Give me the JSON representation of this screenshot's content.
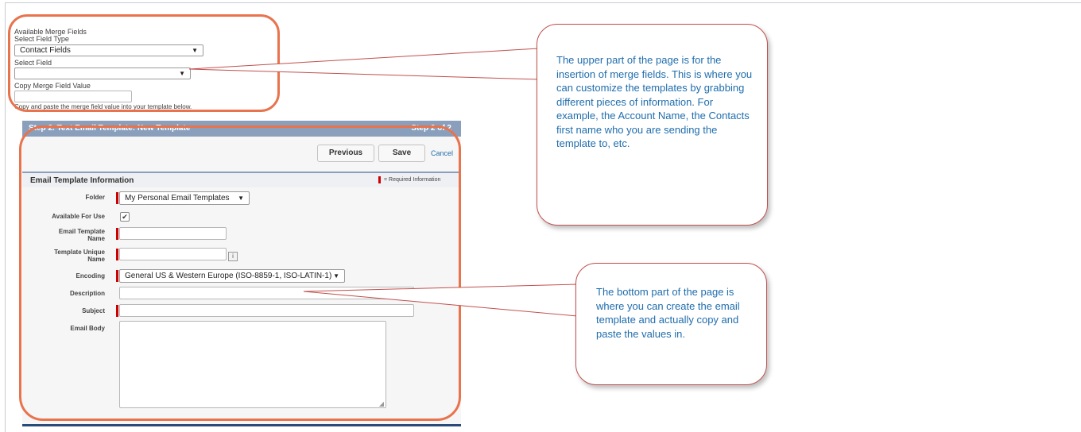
{
  "merge": {
    "title": "Available Merge Fields",
    "field_type_label": "Select Field Type",
    "field_type_value": "Contact Fields",
    "select_field_label": "Select Field",
    "select_field_value": "",
    "copy_label": "Copy Merge Field Value",
    "copy_value": "",
    "hint": "Copy and paste the merge field value into your template below."
  },
  "step": {
    "title": "Step 2. Text Email Template: New Template",
    "counter": "Step 2 of 2"
  },
  "buttons": {
    "previous": "Previous",
    "save": "Save",
    "cancel": "Cancel"
  },
  "section": {
    "title": "Email Template Information",
    "required_note": "= Required Information"
  },
  "form": {
    "folder_label": "Folder",
    "folder_value": "My Personal Email Templates",
    "available_label": "Available For Use",
    "available_checked": true,
    "name_label_1": "Email Template",
    "name_label_2": "Name",
    "unique_label_1": "Template Unique",
    "unique_label_2": "Name",
    "info_icon": "i",
    "encoding_label": "Encoding",
    "encoding_value": "General US & Western Europe (ISO-8859-1, ISO-LATIN-1)",
    "description_label": "Description",
    "subject_label": "Subject",
    "body_label": "Email Body"
  },
  "callouts": {
    "upper": "The upper part of the page is for the insertion of merge fields. This is where you can customize the templates by grabbing different pieces of information. For example, the Account Name, the Contacts first name who you are sending the template to, etc.",
    "lower": "The bottom part of the page is where you can create the email template and actually copy and paste the values in."
  },
  "colors": {
    "highlight": "#e8734d",
    "callout_border": "#c0504d",
    "callout_text": "#1f6dad",
    "step_bar": "#8a9fbc",
    "required": "#cc0000"
  }
}
